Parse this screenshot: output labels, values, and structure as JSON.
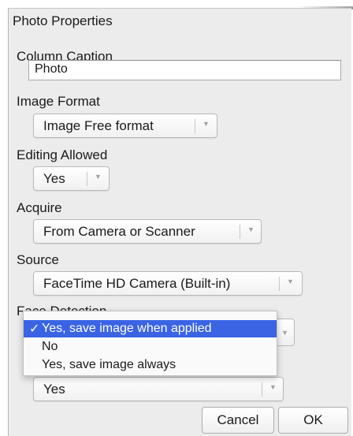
{
  "dialog": {
    "title": "Photo Properties"
  },
  "column_caption": {
    "label": "Column Caption",
    "value": "Photo"
  },
  "image_format": {
    "label": "Image Format",
    "value": "Image Free format"
  },
  "editing_allowed": {
    "label": "Editing Allowed",
    "value": "Yes"
  },
  "acquire": {
    "label": "Acquire",
    "value": "From Camera or Scanner"
  },
  "source": {
    "label": "Source",
    "value": "FaceTime HD Camera (Built-in)"
  },
  "face_detection": {
    "label": "Face Detection",
    "options": [
      {
        "label": "Yes, save image when applied",
        "selected": true
      },
      {
        "label": "No",
        "selected": false
      },
      {
        "label": "Yes, save image always",
        "selected": false
      }
    ]
  },
  "next_field": {
    "value": "Yes"
  },
  "buttons": {
    "cancel": "Cancel",
    "ok": "OK"
  },
  "colors": {
    "menu_selection": "#3a64e4",
    "window_background": "#ececec"
  },
  "icons": {
    "checkmark": "checkmark-icon",
    "popup_arrow": "chevron-down-icon"
  }
}
